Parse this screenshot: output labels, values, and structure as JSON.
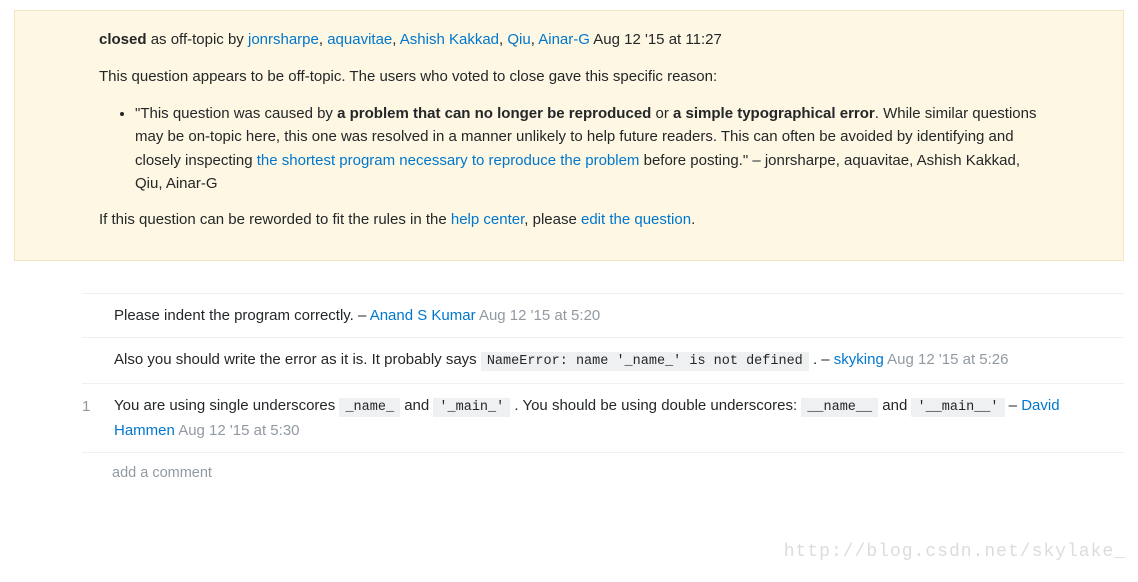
{
  "notice": {
    "closed_bold": "closed",
    "as_text": " as off-topic by ",
    "closers": [
      "jonrsharpe",
      "aquavitae",
      "Ashish Kakkad",
      "Qiu",
      "Ainar-G"
    ],
    "closed_time": "Aug 12 '15 at 11:27",
    "intro": "This question appears to be off-topic. The users who voted to close gave this specific reason:",
    "reason_pre": "\"This question was caused by ",
    "reason_bold1": "a problem that can no longer be reproduced",
    "reason_or": " or ",
    "reason_bold2": "a simple typographical error",
    "reason_mid": ". While similar questions may be on-topic here, this one was resolved in a manner unlikely to help future readers. This can often be avoided by identifying and closely inspecting ",
    "reason_link": "the shortest program necessary to reproduce the problem",
    "reason_post": " before posting.\" – jonrsharpe, aquavitae, Ashish Kakkad, Qiu, Ainar-G",
    "reword_pre": "If this question can be reworded to fit the rules in the ",
    "help_center": "help center",
    "reword_mid": ", please ",
    "edit_question": "edit the question",
    "reword_post": "."
  },
  "comments": [
    {
      "score": "",
      "text": "Please indent the program correctly. – ",
      "author": "Anand S Kumar",
      "time": "Aug 12 '15 at 5:20"
    },
    {
      "score": "",
      "pre": "Also you should write the error as it is. It probably says ",
      "code1": "NameError: name '_name_' is not defined",
      "post": " . – ",
      "author": "skyking",
      "time": "Aug 12 '15 at 5:26"
    },
    {
      "score": "1",
      "pre": "You are using single underscores ",
      "code1": "_name_",
      "mid1": " and ",
      "code2": "'_main_'",
      "mid2": " . You should be using double underscores: ",
      "code3": "__name__",
      "mid3": " and ",
      "code4": "'__main__'",
      "post": " – ",
      "author": "David Hammen",
      "time": "Aug 12 '15 at 5:30"
    }
  ],
  "add_comment": "add a comment",
  "watermark": "http://blog.csdn.net/skylake_"
}
